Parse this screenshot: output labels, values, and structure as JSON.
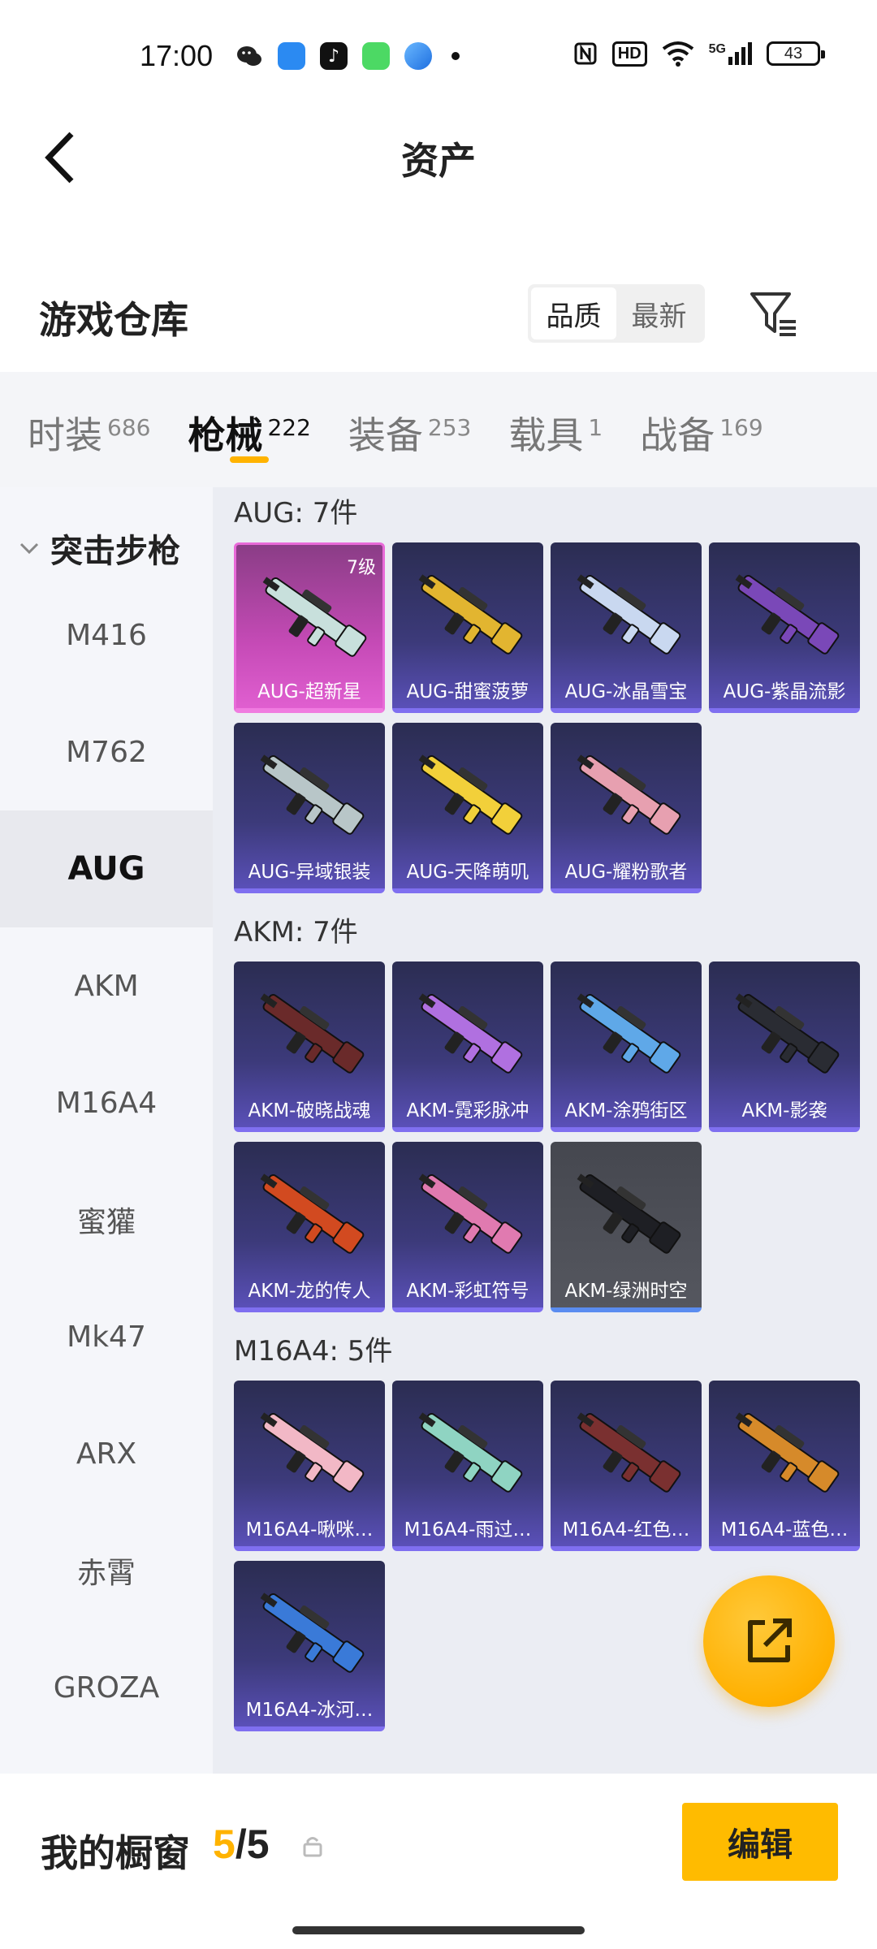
{
  "status_bar": {
    "time": "17:00",
    "hd": "HD",
    "network": "5G",
    "battery": "43",
    "icons_left": [
      "wechat-icon",
      "calendar-app-icon",
      "tiktok-icon",
      "messages-icon",
      "browser-icon"
    ],
    "icons_right": [
      "nfc-icon",
      "hd-icon",
      "wifi-icon",
      "signal-5g-icon",
      "battery-icon"
    ]
  },
  "header": {
    "title": "资产"
  },
  "warehouse": {
    "title": "游戏仓库",
    "sort_options": [
      "品质",
      "最新"
    ],
    "sort_selected": "品质"
  },
  "tabs": [
    {
      "label": "时装",
      "count": "686"
    },
    {
      "label": "枪械",
      "count": "222"
    },
    {
      "label": "装备",
      "count": "253"
    },
    {
      "label": "载具",
      "count": "1"
    },
    {
      "label": "战备",
      "count": "169"
    }
  ],
  "active_tab": "枪械",
  "side": {
    "group": "突击步枪",
    "items": [
      "M416",
      "M762",
      "AUG",
      "AKM",
      "M16A4",
      "蜜獾",
      "Mk47",
      "ARX",
      "赤霄",
      "GROZA"
    ],
    "active": "AUG"
  },
  "groups": [
    {
      "label": "AUG: 7件",
      "items": [
        {
          "name": "AUG-超新星",
          "level": "7级",
          "style": "pink",
          "color": "#c8e0dc"
        },
        {
          "name": "AUG-甜蜜菠萝",
          "style": "dark",
          "color": "#e2b530"
        },
        {
          "name": "AUG-冰晶雪宝",
          "style": "dark",
          "color": "#c9d8f0"
        },
        {
          "name": "AUG-紫晶流影",
          "style": "dark",
          "color": "#7a48b8"
        },
        {
          "name": "AUG-异域银装",
          "style": "dark",
          "color": "#b8c6c8"
        },
        {
          "name": "AUG-天降萌叽",
          "style": "dark",
          "color": "#f2d03a"
        },
        {
          "name": "AUG-耀粉歌者",
          "style": "dark",
          "color": "#e7a0b0"
        }
      ]
    },
    {
      "label": "AKM: 7件",
      "items": [
        {
          "name": "AKM-破晓战魂",
          "style": "dark",
          "color": "#6a2a2a"
        },
        {
          "name": "AKM-霓彩脉冲",
          "style": "dark",
          "color": "#b070e0"
        },
        {
          "name": "AKM-涂鸦街区",
          "style": "dark",
          "color": "#5fa8e8"
        },
        {
          "name": "AKM-影袭",
          "style": "dark",
          "color": "#2a2c33"
        },
        {
          "name": "AKM-龙的传人",
          "style": "dark",
          "color": "#d24a20"
        },
        {
          "name": "AKM-彩虹符号",
          "style": "dark",
          "color": "#e07ab0"
        },
        {
          "name": "AKM-绿洲时空",
          "style": "grey",
          "color": "#1e1f24"
        }
      ]
    },
    {
      "label": "M16A4: 5件",
      "items": [
        {
          "name": "M16A4-啾咪…",
          "style": "dark",
          "color": "#f2b8c6"
        },
        {
          "name": "M16A4-雨过…",
          "style": "dark",
          "color": "#8fd4c2"
        },
        {
          "name": "M16A4-红色…",
          "style": "dark",
          "color": "#7a3030"
        },
        {
          "name": "M16A4-蓝色…",
          "style": "dark",
          "color": "#d68a2a"
        },
        {
          "name": "M16A4-冰河…",
          "style": "dark",
          "color": "#3a7ad8"
        }
      ]
    }
  ],
  "bottom": {
    "label": "我的橱窗",
    "used": "5",
    "separator": "/",
    "total": "5",
    "edit_label": "编辑"
  },
  "colors": {
    "accent": "#ffb300",
    "card_bg": "#3c3a7a",
    "highlight_card": "#c54ab6"
  }
}
